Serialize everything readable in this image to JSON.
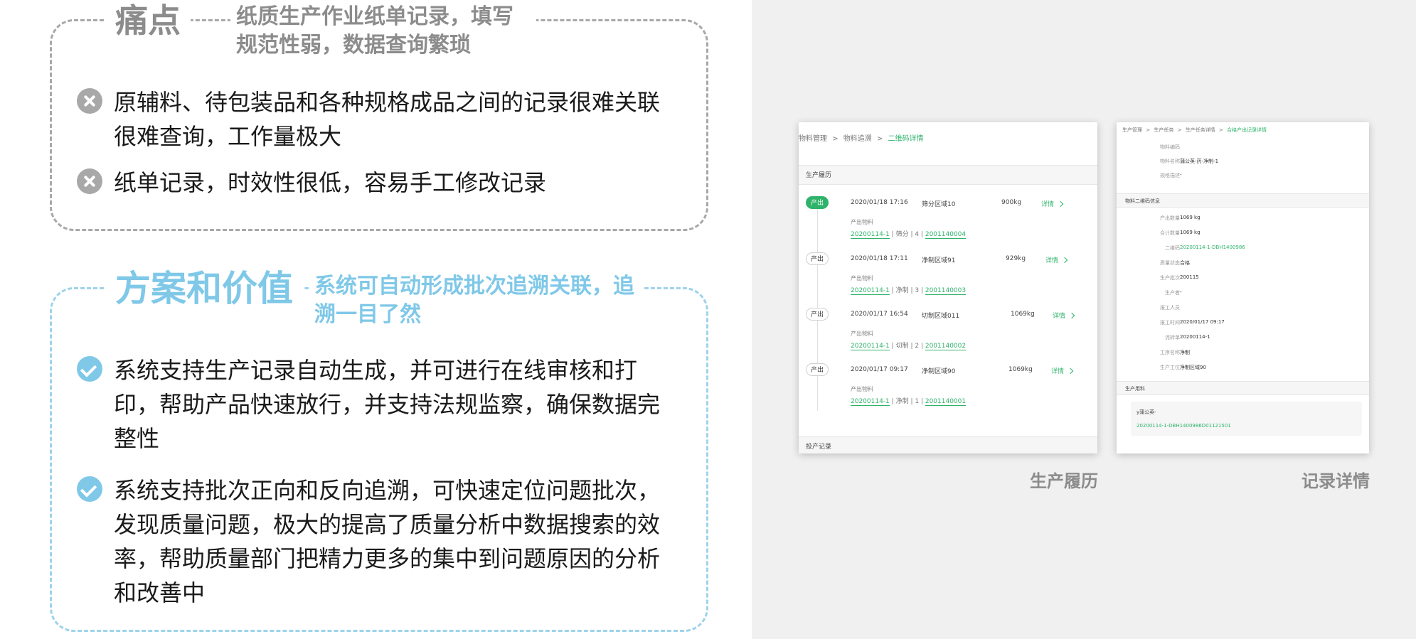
{
  "pain": {
    "title": "痛点",
    "subtitle": "纸质生产作业纸单记录，填写规范性弱，数据查询繁琐",
    "items": [
      {
        "icon": "x-circle-icon",
        "text": "原辅料、待包装品和各种规格成品之间的记录很难关联很难查询，工作量极大"
      },
      {
        "icon": "x-circle-icon",
        "text": "纸单记录，时效性很低，容易手工修改记录"
      }
    ]
  },
  "solution": {
    "title": "方案和价值",
    "subtitle": "系统可自动形成批次追溯关联，追溯一目了然",
    "items": [
      {
        "icon": "check-circle-icon",
        "text": "系统支持生产记录自动生成，并可进行在线审核和打印，帮助产品快速放行，并支持法规监察，确保数据完整性"
      },
      {
        "icon": "check-circle-icon",
        "text": "系统支持批次正向和反向追溯，可快速定位问题批次，发现质量问题，极大的提高了质量分析中数据搜索的效率，帮助质量部门把精力更多的集中到问题原因的分析和改善中"
      }
    ]
  },
  "colors": {
    "pain_accent": "#a8a8a8",
    "solution_accent": "#7fc8e8",
    "green": "#2fb36b",
    "panel_bg": "#f0f0f0"
  },
  "history_screen": {
    "breadcrumb": [
      "物料管理",
      "物料追溯",
      "二维码详情"
    ],
    "separator": ">",
    "section_title": "生产履历",
    "rows": [
      {
        "badge": "产出",
        "active": true,
        "time": "2020/01/18 17:16",
        "area": "筛分区域10",
        "weight": "900kg",
        "detail": "详情",
        "label": "产出物料",
        "batch": "20200114-1",
        "process": "筛分",
        "seq": "4",
        "code": "2001140004"
      },
      {
        "badge": "产出",
        "active": false,
        "time": "2020/01/18 17:11",
        "area": "净制区域91",
        "weight": "929kg",
        "detail": "详情",
        "label": "产出物料",
        "batch": "20200114-1",
        "process": "净制",
        "seq": "3",
        "code": "2001140003"
      },
      {
        "badge": "产出",
        "active": false,
        "time": "2020/01/17 16:54",
        "area": "切制区域011",
        "weight": "1069kg",
        "detail": "详情",
        "label": "产出物料",
        "batch": "20200114-1",
        "process": "切制",
        "seq": "2",
        "code": "2001140002"
      },
      {
        "badge": "产出",
        "active": false,
        "time": "2020/01/17 09:17",
        "area": "净制区域90",
        "weight": "1069kg",
        "detail": "详情",
        "label": "产出物料",
        "batch": "20200114-1",
        "process": "净制",
        "seq": "1",
        "code": "2001140001"
      }
    ],
    "footer_section": "投产记录",
    "caption": "生产履历"
  },
  "detail_screen": {
    "breadcrumb": [
      "生产管理",
      "生产任务",
      "生产任务详情",
      "合格产出记录详情"
    ],
    "separator": ">",
    "top_fields": [
      {
        "k": "物料编码",
        "v": ""
      },
      {
        "k": "物料名称",
        "v": "蒲公英-药-净制-1"
      },
      {
        "k": "规格描述",
        "v": "-"
      }
    ],
    "qr_section": "物料二维码信息",
    "qr_fields": [
      {
        "k": "产出数量",
        "v": "1069 kg",
        "green": false
      },
      {
        "k": "合计数量",
        "v": "1069 kg",
        "green": false
      },
      {
        "k": "二维码",
        "v": "20200114-1-DBH1400986",
        "green": true
      },
      {
        "k": "质量状态",
        "v": "合格",
        "green": false
      },
      {
        "k": "生产批次",
        "v": "200115",
        "green": false
      },
      {
        "k": "生产者",
        "v": "-",
        "green": false
      },
      {
        "k": "报工人员",
        "v": "",
        "green": false
      },
      {
        "k": "报工时间",
        "v": "2020/01/17 09:17",
        "green": false
      },
      {
        "k": "流转单",
        "v": "20200114-1",
        "green": false
      },
      {
        "k": "工序名称",
        "v": "净制",
        "green": false
      },
      {
        "k": "生产工位",
        "v": "净制区域90",
        "green": false
      }
    ],
    "input_section": "生产用料",
    "material_title": "y蒲公英-",
    "material_code": "20200114-1-DBH1400986D01121501",
    "caption": "记录详情"
  }
}
